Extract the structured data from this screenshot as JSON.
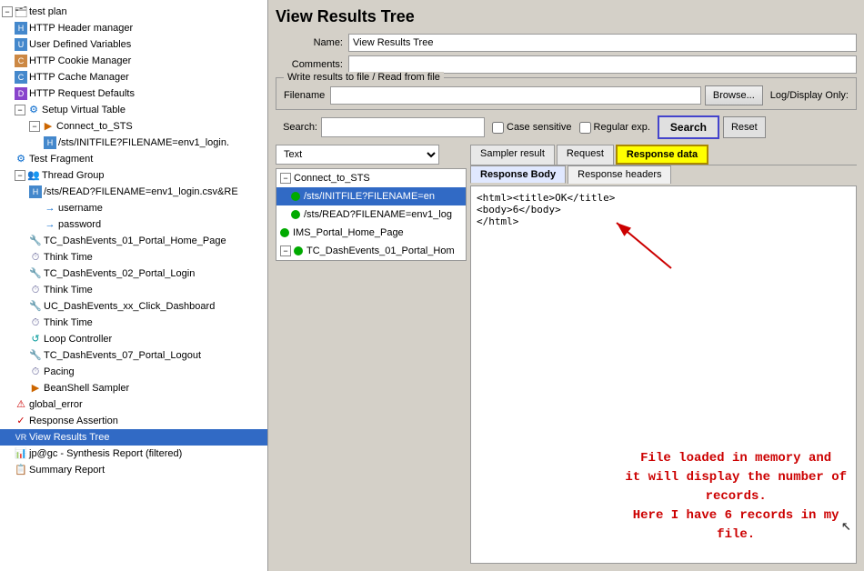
{
  "app": {
    "title": "View Results Tree"
  },
  "left_panel": {
    "items": [
      {
        "id": "test-plan",
        "label": "test plan",
        "indent": 0,
        "icon": "testplan",
        "expand": "minus"
      },
      {
        "id": "http-header-manager",
        "label": "HTTP Header manager",
        "indent": 1,
        "icon": "http"
      },
      {
        "id": "user-defined-variables",
        "label": "User Defined Variables",
        "indent": 1,
        "icon": "http"
      },
      {
        "id": "http-cookie-manager",
        "label": "HTTP Cookie Manager",
        "indent": 1,
        "icon": "cookie"
      },
      {
        "id": "http-cache-manager",
        "label": "HTTP Cache Manager",
        "indent": 1,
        "icon": "http"
      },
      {
        "id": "http-request-defaults",
        "label": "HTTP Request Defaults",
        "indent": 1,
        "icon": "defaults"
      },
      {
        "id": "setup-virtual-table",
        "label": "Setup Virtual Table",
        "indent": 1,
        "icon": "setup",
        "expand": "minus"
      },
      {
        "id": "connect-to-sts",
        "label": "Connect_to_STS",
        "indent": 2,
        "icon": "sampler",
        "expand": "minus"
      },
      {
        "id": "initfile",
        "label": "/sts/INITFILE?FILENAME=env1_login.",
        "indent": 3,
        "icon": "http"
      },
      {
        "id": "test-fragment",
        "label": "Test Fragment",
        "indent": 1,
        "icon": "setup"
      },
      {
        "id": "thread-group",
        "label": "Thread Group",
        "indent": 1,
        "icon": "thread",
        "expand": "minus"
      },
      {
        "id": "sts-read",
        "label": "/sts/READ?FILENAME=env1_login.csv&RE",
        "indent": 2,
        "icon": "http"
      },
      {
        "id": "username",
        "label": "username",
        "indent": 3,
        "icon": "arrow"
      },
      {
        "id": "password",
        "label": "password",
        "indent": 3,
        "icon": "arrow"
      },
      {
        "id": "tc-dashevents-01",
        "label": "TC_DashEvents_01_Portal_Home_Page",
        "indent": 2,
        "icon": "controller"
      },
      {
        "id": "think-time-1",
        "label": "Think Time",
        "indent": 2,
        "icon": "timer"
      },
      {
        "id": "tc-dashevents-02",
        "label": "TC_DashEvents_02_Portal_Login",
        "indent": 2,
        "icon": "controller"
      },
      {
        "id": "think-time-2",
        "label": "Think Time",
        "indent": 2,
        "icon": "timer"
      },
      {
        "id": "uc-dashevents-xx",
        "label": "UC_DashEvents_xx_Click_Dashboard",
        "indent": 2,
        "icon": "controller"
      },
      {
        "id": "think-time-3",
        "label": "Think Time",
        "indent": 2,
        "icon": "timer"
      },
      {
        "id": "loop-controller",
        "label": "Loop Controller",
        "indent": 2,
        "icon": "controller"
      },
      {
        "id": "tc-dashevents-07",
        "label": "TC_DashEvents_07_Portal_Logout",
        "indent": 2,
        "icon": "controller"
      },
      {
        "id": "pacing",
        "label": "Pacing",
        "indent": 2,
        "icon": "timer"
      },
      {
        "id": "beanshell-sampler",
        "label": "BeanShell Sampler",
        "indent": 2,
        "icon": "sampler"
      },
      {
        "id": "global-error",
        "label": "global_error",
        "indent": 1,
        "icon": "assertion"
      },
      {
        "id": "response-assertion",
        "label": "Response Assertion",
        "indent": 1,
        "icon": "assertion"
      },
      {
        "id": "view-results-tree",
        "label": "View Results Tree",
        "indent": 1,
        "icon": "listener",
        "selected": true
      },
      {
        "id": "jp-gc-synthesis",
        "label": "jp@gc - Synthesis Report (filtered)",
        "indent": 1,
        "icon": "synthesis"
      },
      {
        "id": "summary-report",
        "label": "Summary Report",
        "indent": 1,
        "icon": "summary"
      }
    ]
  },
  "right_panel": {
    "title": "View Results Tree",
    "name_label": "Name:",
    "name_value": "View Results Tree",
    "comments_label": "Comments:",
    "write_results_legend": "Write results to file / Read from file",
    "filename_label": "Filename",
    "browse_btn": "Browse...",
    "log_display_label": "Log/Display Only:",
    "search_label": "Search:",
    "case_sensitive_label": "Case sensitive",
    "regular_exp_label": "Regular exp.",
    "search_btn": "Search",
    "reset_btn": "Reset",
    "text_dropdown_value": "Text",
    "tabs": [
      {
        "id": "sampler-result",
        "label": "Sampler result"
      },
      {
        "id": "request",
        "label": "Request"
      },
      {
        "id": "response-data",
        "label": "Response data",
        "active": true
      }
    ],
    "sub_tabs": [
      {
        "id": "response-body",
        "label": "Response Body",
        "active": true
      },
      {
        "id": "response-headers",
        "label": "Response headers"
      }
    ],
    "result_items": [
      {
        "id": "connect-to-sts",
        "label": "Connect_to_STS",
        "indent": 0,
        "expand": "minus",
        "status": null
      },
      {
        "id": "initfile-result",
        "label": "/sts/INITFILE?FILENAME=en",
        "indent": 1,
        "status": "green",
        "selected": true
      },
      {
        "id": "sts-read-result",
        "label": "/sts/READ?FILENAME=env1_log",
        "indent": 1,
        "status": "green"
      },
      {
        "id": "ims-portal",
        "label": "IMS_Portal_Home_Page",
        "indent": 0,
        "status": "green"
      },
      {
        "id": "tc-dashevents-result",
        "label": "TC_DashEvents_01_Portal_Hom",
        "indent": 0,
        "expand": "minus",
        "status": "green"
      }
    ],
    "response_content": "<html><title>OK</title>\n<body>6</body>\n</html>",
    "annotation": {
      "line1": "File loaded in memory and",
      "line2": "it will display the number of",
      "line3": "records.",
      "line4": "Here I have 6 records in my",
      "line5": "file."
    }
  }
}
